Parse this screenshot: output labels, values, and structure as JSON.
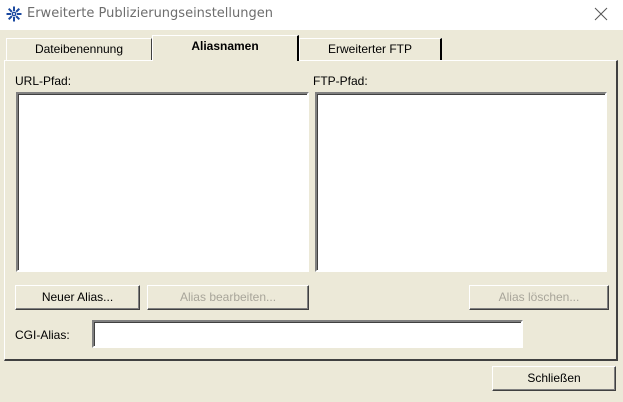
{
  "window": {
    "title": "Erweiterte Publizierungseinstellungen",
    "app_icon": "gear-star-icon",
    "close_icon": "close-icon"
  },
  "tabs": [
    {
      "label": "Dateibenennung",
      "active": false
    },
    {
      "label": "Aliasnamen",
      "active": true
    },
    {
      "label": "Erweiterter FTP",
      "active": false
    }
  ],
  "panel": {
    "url_path_label": "URL-Pfad:",
    "ftp_path_label": "FTP-Pfad:",
    "new_alias_button": "Neuer Alias...",
    "edit_alias_button": "Alias bearbeiten...",
    "delete_alias_button": "Alias löschen...",
    "cgi_alias_label": "CGI-Alias:",
    "cgi_alias_value": ""
  },
  "footer": {
    "close_button": "Schließen"
  },
  "colors": {
    "accent_icon": "#1c4aa0",
    "disabled_text": "#a8a59a",
    "dialog_bg": "#ece9d8"
  }
}
